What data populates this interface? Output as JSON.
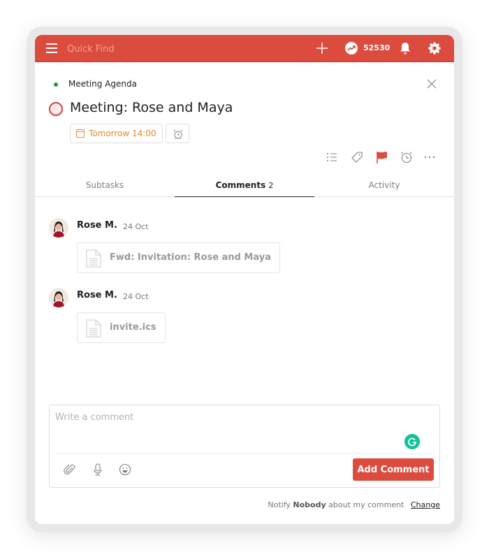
{
  "topbar": {
    "search_placeholder": "Quick Find",
    "karma_value": "52530",
    "icons": [
      "menu-icon",
      "plus-icon",
      "karma-icon",
      "bell-icon",
      "gear-icon"
    ],
    "color": "#db4c3f"
  },
  "task": {
    "project": "Meeting Agenda",
    "project_color": "#299438",
    "title": "Meeting: Rose and Maya",
    "due": "Tomorrow 14:00",
    "due_color": "#e38a2b",
    "priority_color": "#db4c3f",
    "actions": [
      "subtasks-list-icon",
      "label-icon",
      "priority-flag-icon",
      "reminder-alarm-icon",
      "more-icon"
    ]
  },
  "tabs": [
    {
      "label": "Subtasks",
      "count": "",
      "active": false
    },
    {
      "label": "Comments",
      "count": "2",
      "active": true
    },
    {
      "label": "Activity",
      "count": "",
      "active": false
    }
  ],
  "comments": [
    {
      "author": "Rose M.",
      "date": "24 Oct",
      "attachment": "Fwd: Invitation: Rose and Maya"
    },
    {
      "author": "Rose M.",
      "date": "24 Oct",
      "attachment": "invite.ics"
    }
  ],
  "composer": {
    "placeholder": "Write a comment",
    "value": "",
    "submit_label": "Add Comment",
    "icons": [
      "attachment-icon",
      "microphone-icon",
      "emoji-icon",
      "grammarly-icon"
    ]
  },
  "notify": {
    "prefix": "Notify",
    "who": "Nobody",
    "suffix": "about my comment",
    "change_label": "Change"
  }
}
